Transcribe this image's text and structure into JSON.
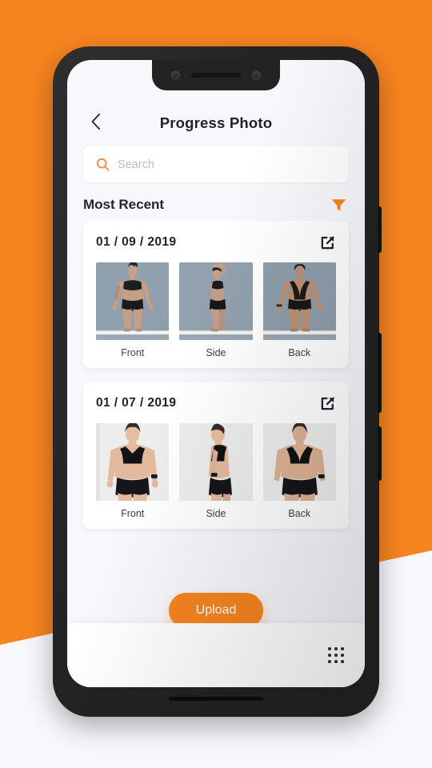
{
  "background": {
    "accent_color": "#f7841f",
    "page_color": "#f7f8fc"
  },
  "device": {
    "frame_color": "#232323",
    "screen_color": "#f7f8fc"
  },
  "header": {
    "back_icon": "chevron-left-icon",
    "title": "Progress Photo"
  },
  "search": {
    "icon": "search-icon",
    "placeholder": "Search",
    "value": ""
  },
  "section": {
    "title": "Most Recent",
    "filter_icon": "filter-icon",
    "filter_color": "#f7841f"
  },
  "cards": [
    {
      "date": "01 / 09 / 2019",
      "share_icon": "share-icon",
      "photos": [
        {
          "label": "Front",
          "pose": "front",
          "bg": "#8e9eab"
        },
        {
          "label": "Side",
          "pose": "side",
          "bg": "#8e9eab"
        },
        {
          "label": "Back",
          "pose": "back",
          "bg": "#8e9eab"
        }
      ]
    },
    {
      "date": "01 / 07 / 2019",
      "share_icon": "share-icon",
      "photos": [
        {
          "label": "Front",
          "pose": "front",
          "bg": "#ececed"
        },
        {
          "label": "Side",
          "pose": "side",
          "bg": "#ececed"
        },
        {
          "label": "Back",
          "pose": "back",
          "bg": "#ececed"
        }
      ]
    }
  ],
  "upload": {
    "label": "Upload",
    "color": "#f7841f"
  },
  "bottom_bar": {
    "menu_icon": "grid-dots-icon"
  }
}
